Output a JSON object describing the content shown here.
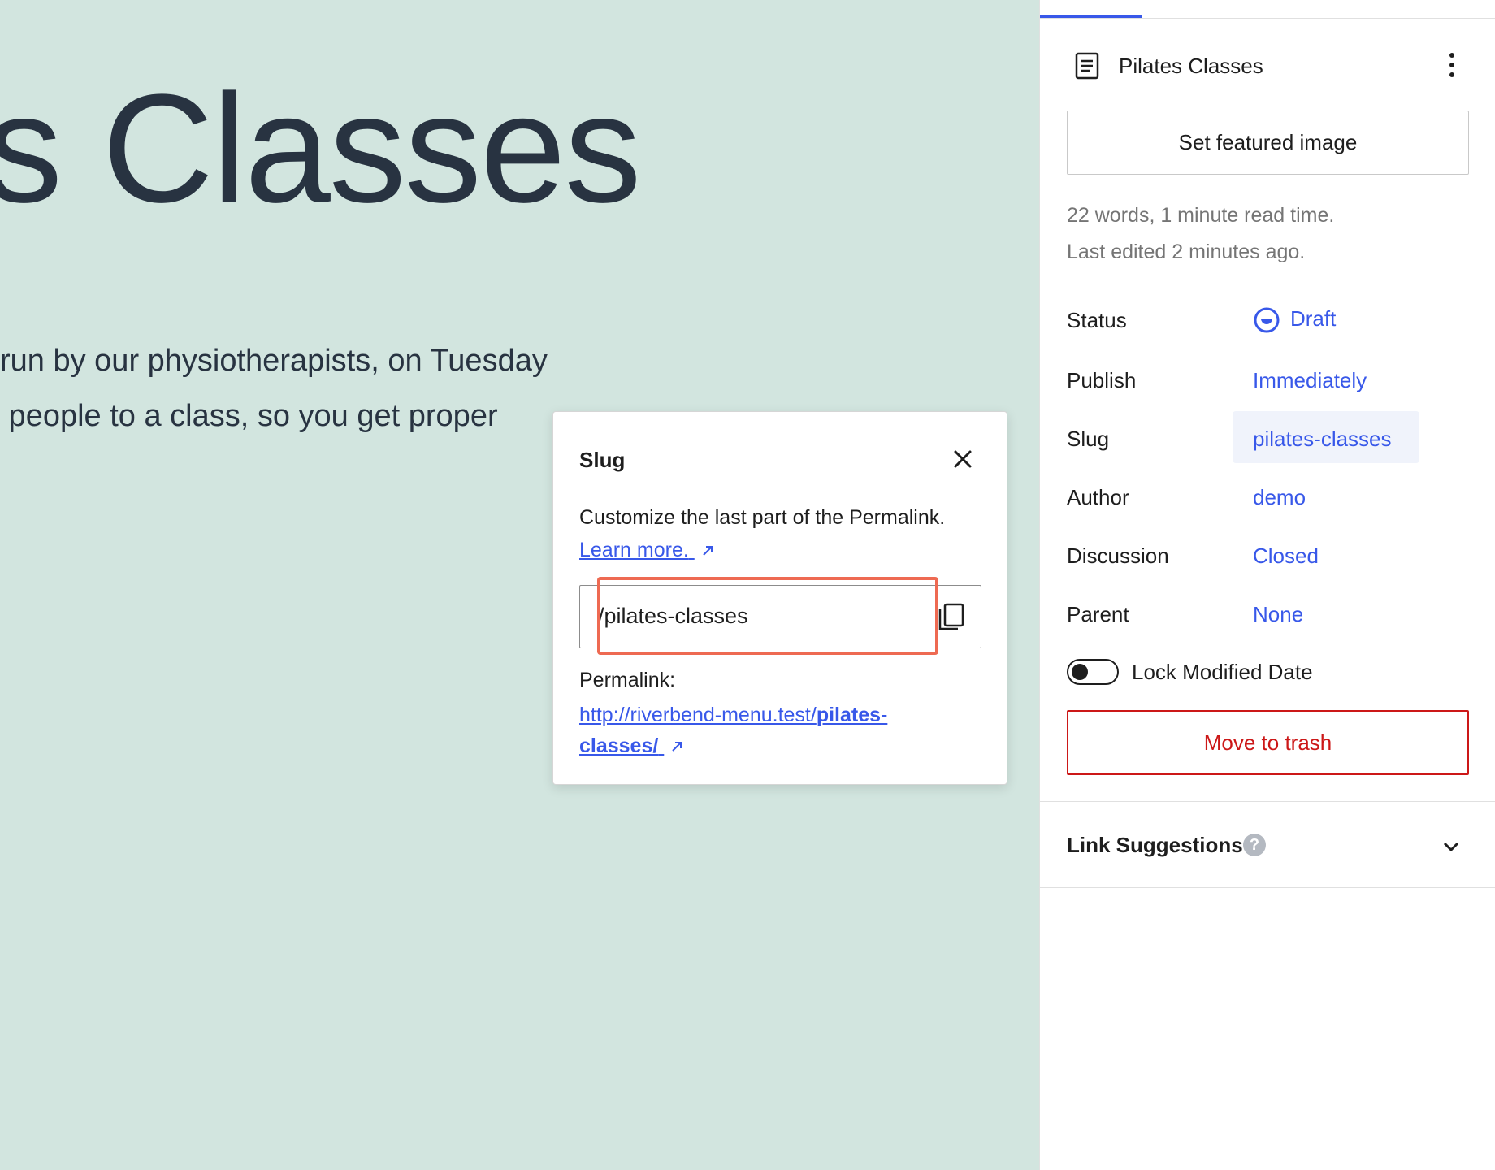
{
  "canvas": {
    "title": "s Classes",
    "paragraph_lines": [
      "run by our physiotherapists, on Tuesday",
      " people to a class, so you get proper"
    ],
    "background": "#d2e5df"
  },
  "slug_popover": {
    "title": "Slug",
    "description": "Customize the last part of the Permalink.",
    "learn_more": "Learn more.",
    "slug_value": "/pilates-classes",
    "permalink_label": "Permalink:",
    "permalink_base": "http://riverbend-menu.test/",
    "permalink_slug": "pilates-classes/"
  },
  "sidebar": {
    "post_title": "Pilates Classes",
    "featured_image_label": "Set featured image",
    "word_count_text": "22 words, 1 minute read time.",
    "last_edited_text": "Last edited 2 minutes ago.",
    "rows": [
      {
        "label": "Status",
        "value": "Draft"
      },
      {
        "label": "Publish",
        "value": "Immediately"
      },
      {
        "label": "Slug",
        "value": "pilates-classes"
      },
      {
        "label": "Author",
        "value": "demo"
      },
      {
        "label": "Discussion",
        "value": "Closed"
      },
      {
        "label": "Parent",
        "value": "None"
      }
    ],
    "lock_modified_label": "Lock Modified Date",
    "trash_label": "Move to trash",
    "link_suggestions_title": "Link Suggestions",
    "help_glyph": "?"
  },
  "colors": {
    "accent": "#3858e9",
    "danger": "#cc1818",
    "highlight": "#ee6a52"
  }
}
